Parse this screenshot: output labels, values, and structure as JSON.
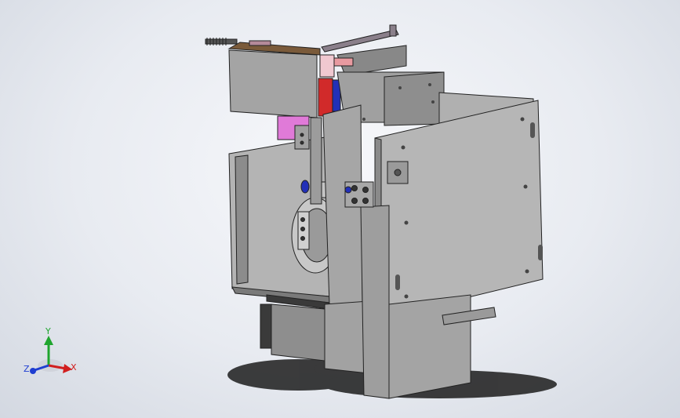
{
  "viewport": {
    "background_top": "#f7f8fb",
    "background_bottom": "#d3d8e1"
  },
  "triad": {
    "x_label": "X",
    "y_label": "Y",
    "z_label": "Z",
    "x_color": "#d11f1f",
    "y_color": "#1fa52e",
    "z_color": "#1f3ed1"
  },
  "model": {
    "body_color": "#9a9a9a",
    "plate_color": "#a8a8a8",
    "dark_color": "#3a3a3a",
    "accent_red": "#d12a2a",
    "accent_blue": "#2230b8",
    "accent_pink": "#e07ad8",
    "accent_green": "#3fbf3f"
  }
}
